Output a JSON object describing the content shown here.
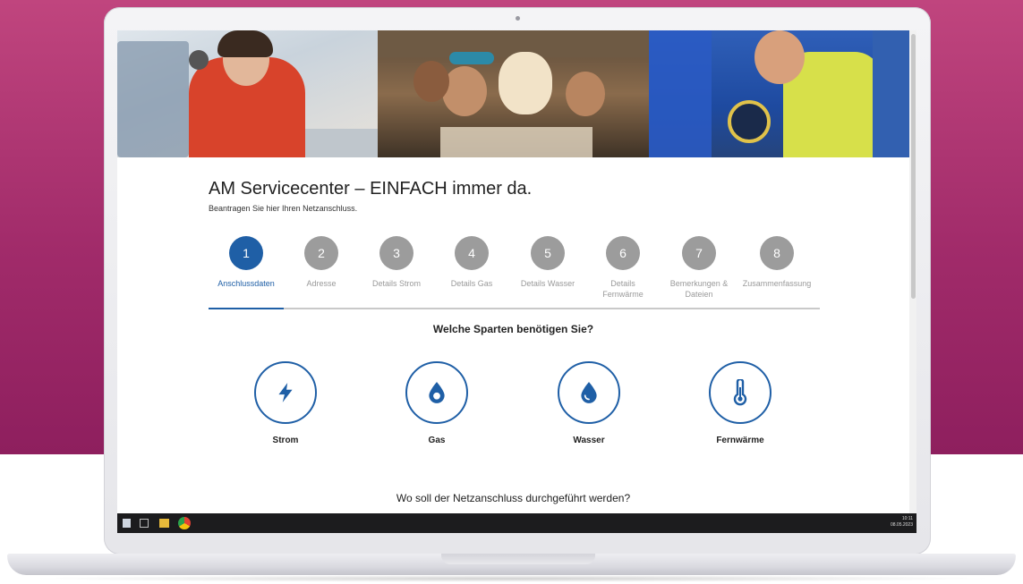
{
  "page": {
    "title": "AM Servicecenter – EINFACH immer da.",
    "subtitle": "Beantragen Sie hier Ihren Netzanschluss."
  },
  "steps": [
    {
      "number": "1",
      "label": "Anschlussdaten",
      "active": true
    },
    {
      "number": "2",
      "label": "Adresse",
      "active": false
    },
    {
      "number": "3",
      "label": "Details Strom",
      "active": false
    },
    {
      "number": "4",
      "label": "Details Gas",
      "active": false
    },
    {
      "number": "5",
      "label": "Details Wasser",
      "active": false
    },
    {
      "number": "6",
      "label": "Details Fernwärme",
      "active": false
    },
    {
      "number": "7",
      "label": "Bemerkungen & Dateien",
      "active": false
    },
    {
      "number": "8",
      "label": "Zusammenfassung",
      "active": false
    }
  ],
  "sparten": {
    "question": "Welche Sparten benötigen Sie?",
    "items": [
      {
        "label": "Strom",
        "icon": "lightning-icon"
      },
      {
        "label": "Gas",
        "icon": "flame-drop-icon"
      },
      {
        "label": "Wasser",
        "icon": "water-drop-icon"
      },
      {
        "label": "Fernwärme",
        "icon": "thermometer-icon"
      }
    ]
  },
  "location": {
    "question": "Wo soll der Netzanschluss durchgeführt werden?"
  },
  "taskbar": {
    "time": "10:11",
    "date": "08.05.2023"
  },
  "colors": {
    "accent": "#1f5fa6",
    "inactive_step": "#9c9c9c",
    "background_magenta": "#a12b6a"
  }
}
